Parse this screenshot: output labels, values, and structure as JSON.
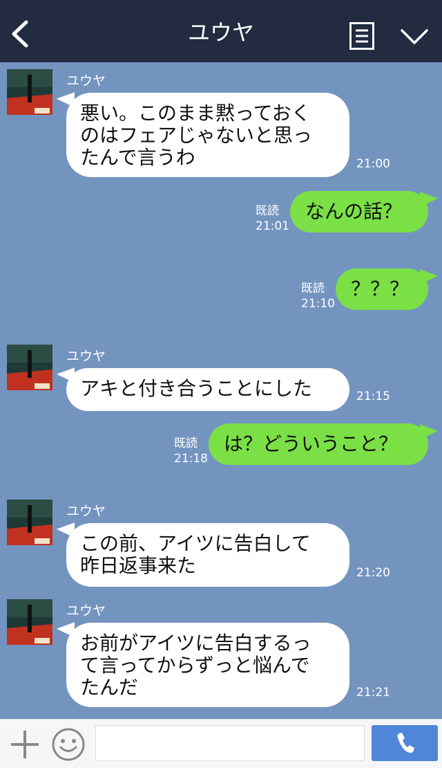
{
  "header": {
    "title": "ユウヤ"
  },
  "colors": {
    "header_bg": "#222b3f",
    "chat_bg": "#7494c0",
    "outgoing": "#7ae046",
    "incoming": "#ffffff",
    "send_button": "#4f86d8"
  },
  "icons": {
    "back": "chevron-left-icon",
    "menu": "menu-icon",
    "collapse": "chevron-down-icon",
    "add": "plus-icon",
    "sticker": "smile-icon",
    "call": "phone-icon"
  },
  "messages": [
    {
      "dir": "in",
      "sender": "ユウヤ",
      "text": "悪い。このまま黙っておく\nのはフェアじゃないと思っ\nたんで言うわ",
      "time": "21:00"
    },
    {
      "dir": "out",
      "text": "なんの話？",
      "read": "既読",
      "time": "21:01"
    },
    {
      "dir": "out",
      "text": "？？？",
      "read": "既読",
      "time": "21:10"
    },
    {
      "dir": "in",
      "sender": "ユウヤ",
      "text": "アキと付き合うことにした",
      "time": "21:15"
    },
    {
      "dir": "out",
      "text": "は？どういうこと？",
      "read": "既読",
      "time": "21:18"
    },
    {
      "dir": "in",
      "sender": "ユウヤ",
      "text": "この前、アイツに告白して\n昨日返事来た",
      "time": "21:20"
    },
    {
      "dir": "in",
      "sender": "ユウヤ",
      "text": "お前がアイツに告白するっ\nて言ってからずっと悩んで\nたんだ",
      "time": "21:21"
    }
  ],
  "footer": {
    "input_value": ""
  }
}
